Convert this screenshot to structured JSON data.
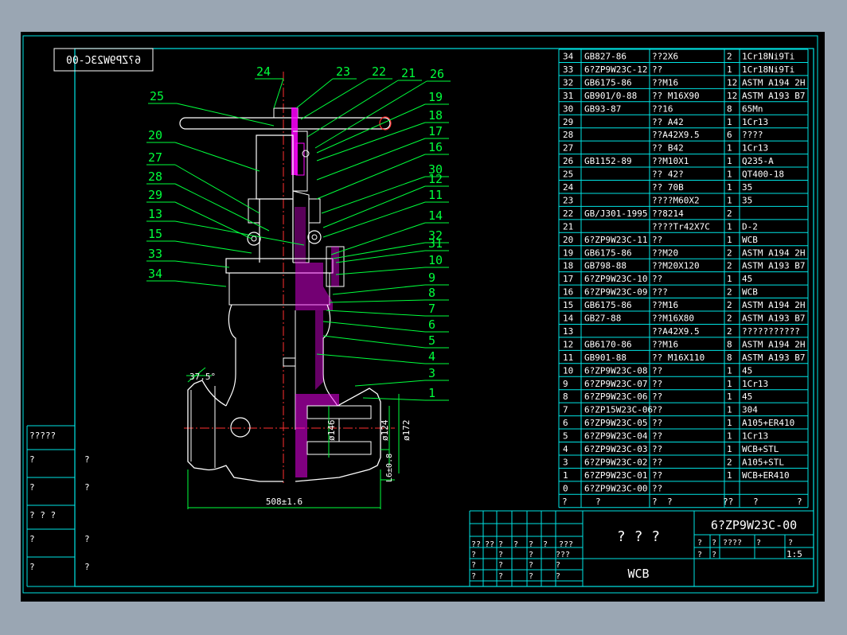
{
  "drawing_code_mirrored": "6?ZP9W23C-00",
  "callouts": [
    "24",
    "23",
    "22",
    "21",
    "26",
    "25",
    "19",
    "18",
    "17",
    "20",
    "16",
    "27",
    "30",
    "28",
    "12",
    "29",
    "11",
    "13",
    "14",
    "15",
    "32",
    "31",
    "33",
    "10",
    "34",
    "9",
    "8",
    "7",
    "6",
    "5",
    "4",
    "3",
    "1"
  ],
  "dimensions": {
    "angle": "37.5°",
    "d146": "ø146",
    "d124": "ø124",
    "d172": "ø172",
    "wall": "L6±0.8",
    "length": "508±1.6"
  },
  "bom": [
    [
      "34",
      "GB827-86",
      "??2X6",
      "2",
      "1Cr18Ni9Ti"
    ],
    [
      "33",
      "6?ZP9W23C-12",
      "??",
      "1",
      "1Cr18Ni9Ti"
    ],
    [
      "32",
      "GB6175-86",
      "??M16",
      "12",
      "ASTM A194 2H"
    ],
    [
      "31",
      "GB901/0-88",
      "?? M16X90",
      "12",
      "ASTM A193 B7"
    ],
    [
      "30",
      "GB93-87",
      "??16",
      "8",
      "65Mn"
    ],
    [
      "29",
      "",
      "?? A42",
      "1",
      "1Cr13"
    ],
    [
      "28",
      "",
      "??A42X9.5",
      "6",
      "????"
    ],
    [
      "27",
      "",
      "?? B42",
      "1",
      "1Cr13"
    ],
    [
      "26",
      "GB1152-89",
      "??M10X1",
      "1",
      "Q235-A"
    ],
    [
      "25",
      "",
      "?? 42?",
      "1",
      "QT400-18"
    ],
    [
      "24",
      "",
      "?? 70B",
      "1",
      "35"
    ],
    [
      "23",
      "",
      "????M60X2",
      "1",
      "35"
    ],
    [
      "22",
      "GB/J301-1995",
      "??8214",
      "2",
      ""
    ],
    [
      "21",
      "",
      "????Tr42X7C",
      "1",
      "D-2"
    ],
    [
      "20",
      "6?ZP9W23C-11",
      "??",
      "1",
      "WCB"
    ],
    [
      "19",
      "GB6175-86",
      "??M20",
      "2",
      "ASTM A194 2H"
    ],
    [
      "18",
      "GB798-88",
      "??M20X120",
      "2",
      "ASTM A193 B7"
    ],
    [
      "17",
      "6?ZP9W23C-10",
      "??",
      "1",
      "45"
    ],
    [
      "16",
      "6?ZP9W23C-09",
      "???",
      "2",
      "WCB"
    ],
    [
      "15",
      "GB6175-86",
      "??M16",
      "2",
      "ASTM A194 2H"
    ],
    [
      "14",
      "GB27-88",
      "??M16X80",
      "2",
      "ASTM A193 B7"
    ],
    [
      "13",
      "",
      "??A42X9.5",
      "2",
      "???????????"
    ],
    [
      "12",
      "GB6170-86",
      "??M16",
      "8",
      "ASTM A194 2H"
    ],
    [
      "11",
      "GB901-88",
      "?? M16X110",
      "8",
      "ASTM A193 B7"
    ],
    [
      "10",
      "6?ZP9W23C-08",
      "??",
      "1",
      "45"
    ],
    [
      "9",
      "6?ZP9W23C-07",
      "??",
      "1",
      "1Cr13"
    ],
    [
      "8",
      "6?ZP9W23C-06",
      "??",
      "1",
      "45"
    ],
    [
      "7",
      "6?ZP15W23C-06",
      "??",
      "1",
      "304"
    ],
    [
      "6",
      "6?ZP9W23C-05",
      "??",
      "1",
      "A105+ER410"
    ],
    [
      "5",
      "6?ZP9W23C-04",
      "??",
      "1",
      "1Cr13"
    ],
    [
      "4",
      "6?ZP9W23C-03",
      "??",
      "1",
      "WCB+STL"
    ],
    [
      "3",
      "6?ZP9W23C-02",
      "??",
      "2",
      "A105+STL"
    ],
    [
      "1",
      "6?ZP9W23C-01",
      "??",
      "1",
      "WCB+ER410"
    ],
    [
      "0",
      "6?ZP9W23C-00",
      "??",
      "",
      ""
    ]
  ],
  "bom_footer": [
    "?",
    "?",
    "?",
    "?",
    "??",
    "?",
    "?"
  ],
  "left_strip": [
    {
      "label": "?????",
      "value": ""
    },
    {
      "label": "?",
      "value": "?"
    },
    {
      "label": "?",
      "value": "?"
    },
    {
      "label": "? ? ?",
      "value": ""
    },
    {
      "label": "?",
      "value": "?"
    },
    {
      "label": "?",
      "value": "?"
    }
  ],
  "title_block": {
    "name": "? ? ?",
    "drawing_no": "6?ZP9W23C-00",
    "material": "WCB",
    "scale": "1:5",
    "grid_row1": [
      "??",
      "??",
      "?",
      "?",
      "?",
      "?",
      "???"
    ],
    "grid_row2": [
      "?",
      "?",
      "?",
      "???"
    ],
    "grid_row3": [
      "?",
      "?",
      "?",
      "?"
    ],
    "grid_row4": [
      "?",
      "?",
      "?",
      "?"
    ],
    "grid_row5": [
      "?",
      "?",
      "?",
      "?"
    ],
    "grid_row6": [
      "?",
      "?",
      "?",
      "?"
    ],
    "mid_row1": [
      "?",
      "?",
      "????",
      "?",
      "?"
    ],
    "mid_row2": [
      "?",
      "?"
    ]
  }
}
